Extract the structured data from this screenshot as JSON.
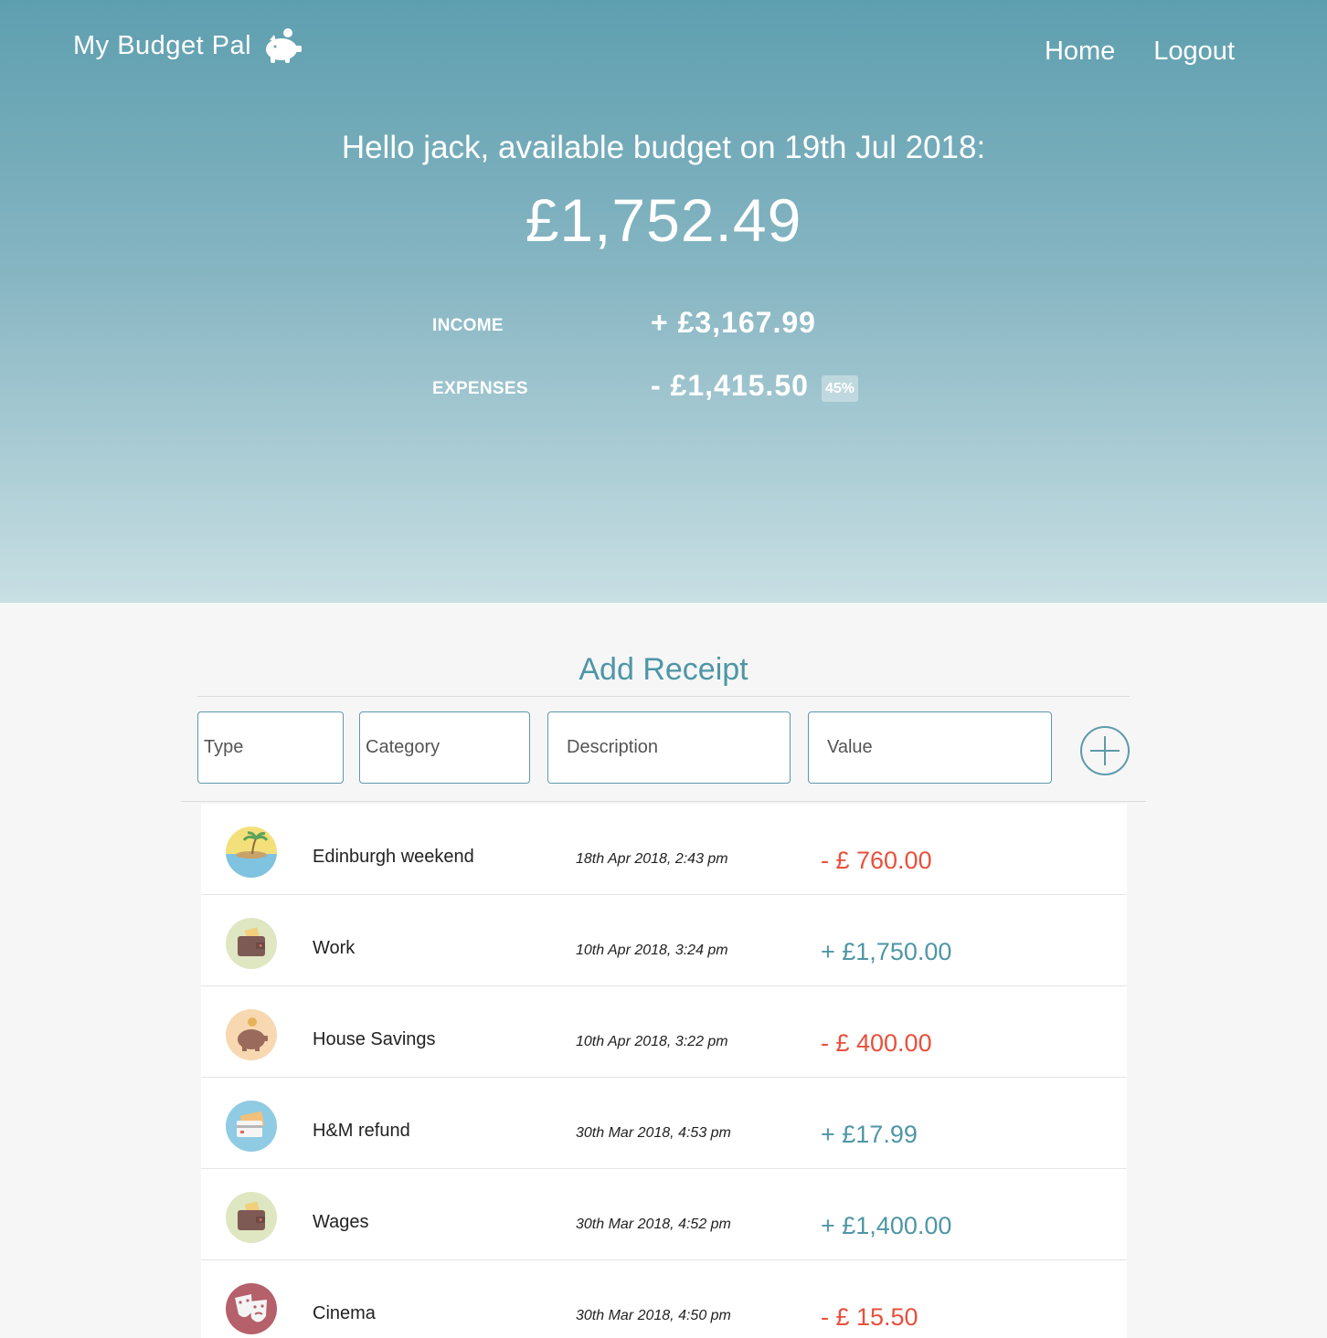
{
  "brand": {
    "name": "My Budget Pal",
    "logo_icon": "piggy-bank-icon"
  },
  "nav": {
    "home": "Home",
    "logout": "Logout"
  },
  "summary": {
    "greeting": "Hello jack, available budget on 19th Jul 2018:",
    "available_budget": "£1,752.49",
    "income_label": "INCOME",
    "income_value": "+ £3,167.99",
    "expenses_label": "EXPENSES",
    "expenses_value": "- £1,415.50",
    "expenses_percent": "45%"
  },
  "add_receipt": {
    "title": "Add Receipt",
    "type_placeholder": "Type",
    "category_placeholder": "Category",
    "description_placeholder": "Description",
    "value_placeholder": "Value",
    "add_icon": "plus-circle-icon"
  },
  "receipts": [
    {
      "icon": "island-icon",
      "description": "Edinburgh weekend",
      "date": "18th Apr 2018, 2:43 pm",
      "amount": "- £ 760.00",
      "type": "expense"
    },
    {
      "icon": "wallet-icon",
      "description": "Work",
      "date": "10th Apr 2018, 3:24 pm",
      "amount": "+ £1,750.00",
      "type": "income"
    },
    {
      "icon": "piggy-bank-icon",
      "description": "House Savings",
      "date": "10th Apr 2018, 3:22 pm",
      "amount": "- £ 400.00",
      "type": "expense"
    },
    {
      "icon": "credit-card-icon",
      "description": "H&M refund",
      "date": "30th Mar 2018, 4:53 pm",
      "amount": "+ £17.99",
      "type": "income"
    },
    {
      "icon": "wallet-icon",
      "description": "Wages",
      "date": "30th Mar 2018, 4:52 pm",
      "amount": "+ £1,400.00",
      "type": "income"
    },
    {
      "icon": "theater-masks-icon",
      "description": "Cinema",
      "date": "30th Mar 2018, 4:50 pm",
      "amount": "- £ 15.50",
      "type": "expense"
    }
  ],
  "colors": {
    "accent": "#4e96a6",
    "expense": "#e8503c",
    "hero_top": "#5e9faf",
    "hero_bottom": "#c8dfe3"
  }
}
